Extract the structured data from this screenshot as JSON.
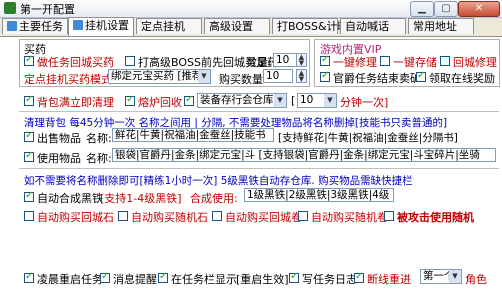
{
  "window": {
    "title": "第一开配置",
    "minimize": "▁",
    "maximize": "▢",
    "close": "✕"
  },
  "tabs": [
    {
      "label": "主要任务"
    },
    {
      "label": "挂机设置",
      "active": true
    },
    {
      "label": "定点挂机"
    },
    {
      "label": "高级设置"
    },
    {
      "label": "打BOSS&计时"
    },
    {
      "label": "自动喊话"
    },
    {
      "label": "常用地址"
    }
  ],
  "buy": {
    "title": "买药",
    "cb_return_buy": "做任务回城买药",
    "cb_advanced_boss": "打高级BOSS前先回城买足药",
    "qty_label": "数量:",
    "qty_value": "10",
    "mode_label": "定点挂机买药模式",
    "mode_value": "绑定元宝买药 [推荐]",
    "buy_qty_label": "购买数量:",
    "buy_qty_value": "10"
  },
  "vip": {
    "title": "游戏内置VIP",
    "cb_repair": "一键修理",
    "cb_store": "一键存储",
    "cb_return_repair": "回城修理",
    "cb_sell": "官爵任务结束卖矿",
    "cb_online_reward": "领取在线奖励"
  },
  "row3": {
    "cb_bag_clean": "背包满立即清理",
    "cb_smelt": "熔炉回收",
    "storage_select": "装备存行会仓库",
    "interval_select": "10",
    "interval_suffix": "分钟一次]"
  },
  "clean": {
    "line1": "清理背包  每45分钟一次  名称之间用 | 分隔, 不需要处理物品将名称删掉[技能书只卖普通的]",
    "cb_sell_label": "出售物品",
    "sell_name_label": "名称:",
    "sell_items": "鲜花|牛黄|祝福油|金蚕丝|技能书",
    "sell_items_tail": "[支持鲜花|牛黄|祝福油|金蚕丝|分隔书]",
    "cb_use_label": "使用物品",
    "use_name_label": "名称:",
    "use_items": "银袋|官爵丹|金条|绑定元宝|斗 [支持银袋|官爵丹|金条|绑定元宝|斗宝碎片|坐骑丹]"
  },
  "merge": {
    "note": "如不需要将名称删除即可[精练1小时一次]  5级黑铁自动存仓库. 购买物品需缺快捷栏",
    "cb_auto_merge": "自动合成黑铁",
    "merge_support": "[支持1-4级黑铁]",
    "merge_use_label": "合成使用:",
    "merge_use_value": "1级黑铁|2级黑铁|3级黑铁|4级黑铁",
    "cb_buy_city_scroll": "自动购买回城石",
    "cb_buy_random_stone": "自动购买随机石",
    "cb_buy_city_book": "自动购买回城卷",
    "cb_buy_random_book": "自动购买随机卷",
    "attacked_note": "被攻击使用随机"
  },
  "bottom": {
    "cb_ling_restart": "凌晨重启任务",
    "cb_msg_alert": "消息提醒",
    "cb_tray": "在任务栏显示",
    "reborn": "[重启生效]",
    "cb_task_log": "写任务日志",
    "cb_reconnect": "断线重进",
    "reconnect_select": "第一个",
    "role_label": "角色"
  },
  "colors": {
    "accent_red": "#c00000",
    "accent_blue": "#0000c0",
    "check_green": "#21a121"
  }
}
